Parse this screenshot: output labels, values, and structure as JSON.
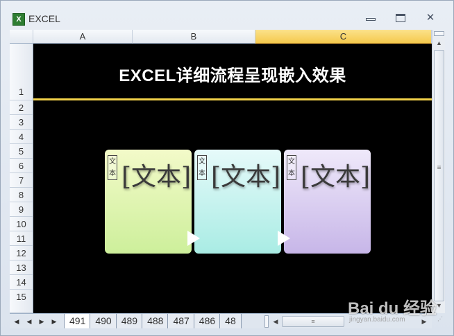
{
  "window": {
    "app_icon": "excel-icon",
    "title": "EXCEL",
    "controls": {
      "minimize": "minimize-icon",
      "maximize": "maximize-icon",
      "close": "close-icon",
      "close_glyph": "✕"
    }
  },
  "columns": [
    "A",
    "B",
    "C"
  ],
  "selected_column": "C",
  "rows": [
    "1",
    "2",
    "3",
    "4",
    "5",
    "6",
    "7",
    "8",
    "9",
    "10",
    "11",
    "12",
    "13",
    "14",
    "15"
  ],
  "sheet": {
    "title": "EXCEL详细流程呈现嵌入效果",
    "title_color": "#ffffff",
    "line_color": "#f2d24a",
    "background": "#000000",
    "cards": [
      {
        "text": "[文本]",
        "mark": "文本"
      },
      {
        "text": "[文本]",
        "mark": "文本"
      },
      {
        "text": "[文本]",
        "mark": "文本"
      }
    ]
  },
  "tabs": {
    "nav": {
      "first": "◀",
      "prev": "◀",
      "next": "▶",
      "last": "▶"
    },
    "items": [
      "491",
      "490",
      "489",
      "488",
      "487",
      "486",
      "48"
    ],
    "active": "491"
  },
  "scroll": {
    "up": "▲",
    "down": "▼",
    "left": "◀",
    "right": "▶",
    "grip": "≡"
  },
  "watermark": {
    "main": "Bai du 经验",
    "sub": "jingyan.baidu.com"
  }
}
